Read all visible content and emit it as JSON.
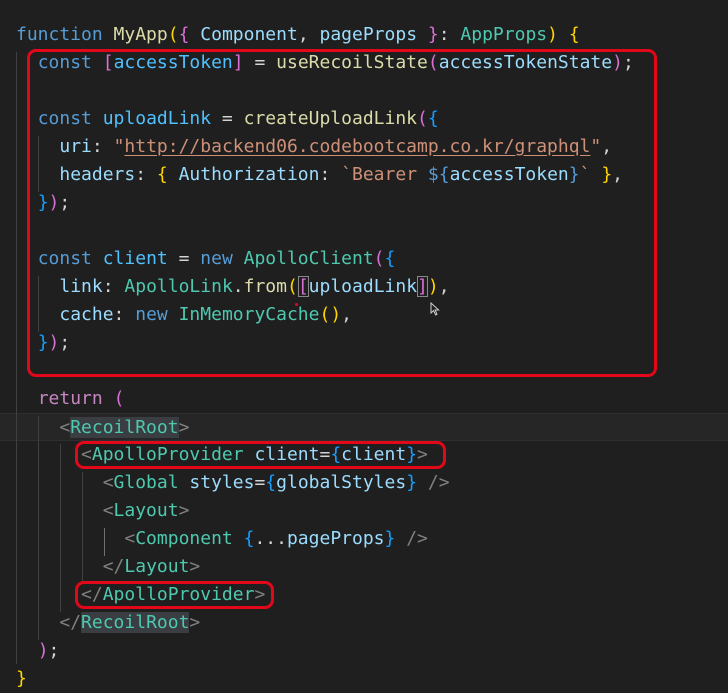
{
  "editor": {
    "colors": {
      "background": "#1f1f1f",
      "keyword": "#569cd6",
      "control_keyword": "#c586c0",
      "function": "#dcdcaa",
      "variable": "#9cdcfe",
      "constant": "#4fc1ff",
      "type": "#4ec9b0",
      "string": "#ce9178",
      "bracket_level_1": "#ffd700",
      "bracket_level_2": "#da70d6",
      "bracket_level_3": "#179fff",
      "highlight_box": "#e3071a"
    },
    "highlight_boxes": [
      "const-block-highlight",
      "apollo-provider-open-highlight",
      "apollo-provider-close-highlight"
    ],
    "mouse_pointer_icon": "text-arrow-cursor",
    "lines": [
      {
        "t": [
          [
            "function",
            "kw"
          ],
          [
            " ",
            "pn"
          ],
          [
            "MyApp",
            "fn"
          ],
          [
            "(",
            "b1"
          ],
          [
            "{",
            "b2"
          ],
          [
            " ",
            "pn"
          ],
          [
            "Component",
            "vr"
          ],
          [
            ", ",
            "pn"
          ],
          [
            "pageProps",
            "vr"
          ],
          [
            " ",
            "pn"
          ],
          [
            "}",
            "b2"
          ],
          [
            ": ",
            "pn"
          ],
          [
            "AppProps",
            "ty"
          ],
          [
            ")",
            "b1"
          ],
          [
            " ",
            "pn"
          ],
          [
            "{",
            "b1"
          ]
        ]
      },
      {
        "t": [
          [
            "  ",
            "pn"
          ],
          [
            "const",
            "kw"
          ],
          [
            " ",
            "pn"
          ],
          [
            "[",
            "b2"
          ],
          [
            "accessToken",
            "cn"
          ],
          [
            "]",
            "b2"
          ],
          [
            " = ",
            "pn"
          ],
          [
            "useRecoilState",
            "fn"
          ],
          [
            "(",
            "b2"
          ],
          [
            "accessTokenState",
            "vr"
          ],
          [
            ")",
            "b2"
          ],
          [
            ";",
            "pn"
          ]
        ]
      },
      {
        "t": []
      },
      {
        "t": [
          [
            "  ",
            "pn"
          ],
          [
            "const",
            "kw"
          ],
          [
            " ",
            "pn"
          ],
          [
            "uploadLink",
            "cn"
          ],
          [
            " = ",
            "pn"
          ],
          [
            "createUploadLink",
            "fn"
          ],
          [
            "(",
            "b2"
          ],
          [
            "{",
            "b3"
          ]
        ]
      },
      {
        "t": [
          [
            "    ",
            "pn"
          ],
          [
            "uri",
            "vr"
          ],
          [
            ": ",
            "pn"
          ],
          [
            "\"",
            "st"
          ],
          [
            "http://backend06.codebootcamp.co.kr/graphql",
            "st url"
          ],
          [
            "\"",
            "st"
          ],
          [
            ",",
            "pn"
          ]
        ]
      },
      {
        "t": [
          [
            "    ",
            "pn"
          ],
          [
            "headers",
            "vr"
          ],
          [
            ": ",
            "pn"
          ],
          [
            "{",
            "b1"
          ],
          [
            " ",
            "pn"
          ],
          [
            "Authorization",
            "vr"
          ],
          [
            ": ",
            "pn"
          ],
          [
            "`Bearer ",
            "st"
          ],
          [
            "${",
            "tpl"
          ],
          [
            "accessToken",
            "vr"
          ],
          [
            "}",
            "tpl"
          ],
          [
            "`",
            "st"
          ],
          [
            " ",
            "pn"
          ],
          [
            "}",
            "b1"
          ],
          [
            ",",
            "pn"
          ]
        ]
      },
      {
        "t": [
          [
            "  ",
            "pn"
          ],
          [
            "}",
            "b3"
          ],
          [
            ")",
            "b2"
          ],
          [
            ";",
            "pn"
          ]
        ]
      },
      {
        "t": []
      },
      {
        "t": [
          [
            "  ",
            "pn"
          ],
          [
            "const",
            "kw"
          ],
          [
            " ",
            "pn"
          ],
          [
            "client",
            "cn"
          ],
          [
            " = ",
            "pn"
          ],
          [
            "new",
            "kw"
          ],
          [
            " ",
            "pn"
          ],
          [
            "ApolloClient",
            "ty"
          ],
          [
            "(",
            "b2"
          ],
          [
            "{",
            "b3"
          ]
        ]
      },
      {
        "t": [
          [
            "    ",
            "pn"
          ],
          [
            "link",
            "vr"
          ],
          [
            ": ",
            "pn"
          ],
          [
            "ApolloLink",
            "ty"
          ],
          [
            ".",
            "pn"
          ],
          [
            "from",
            "fn"
          ],
          [
            "(",
            "b1"
          ],
          [
            "[",
            "b2 bracket-match"
          ],
          [
            "uploadLink",
            "vr"
          ],
          [
            "]",
            "b2 bracket-match"
          ],
          [
            ")",
            "b1"
          ],
          [
            ",",
            "pn"
          ]
        ]
      },
      {
        "t": [
          [
            "    ",
            "pn"
          ],
          [
            "cache",
            "vr"
          ],
          [
            ": ",
            "pn"
          ],
          [
            "new",
            "kw"
          ],
          [
            " ",
            "pn"
          ],
          [
            "InMemoryCache",
            "ty"
          ],
          [
            "()",
            "b1"
          ],
          [
            ",",
            "pn"
          ]
        ]
      },
      {
        "t": [
          [
            "  ",
            "pn"
          ],
          [
            "}",
            "b3"
          ],
          [
            ")",
            "b2"
          ],
          [
            ";",
            "pn"
          ]
        ]
      },
      {
        "t": []
      },
      {
        "t": [
          [
            "  ",
            "pn"
          ],
          [
            "return",
            "ctl"
          ],
          [
            " ",
            "pn"
          ],
          [
            "(",
            "b2"
          ]
        ]
      },
      {
        "t": [
          [
            "    ",
            "pn"
          ],
          [
            "<",
            "ang"
          ],
          [
            "RecoilRoot",
            "tg tag-match"
          ],
          [
            ">",
            "ang"
          ]
        ]
      },
      {
        "t": [
          [
            "      ",
            "pn"
          ],
          [
            "<",
            "ang"
          ],
          [
            "ApolloProvider",
            "tg"
          ],
          [
            " ",
            "pn"
          ],
          [
            "client",
            "at"
          ],
          [
            "=",
            "pn"
          ],
          [
            "{",
            "b3"
          ],
          [
            "client",
            "vr"
          ],
          [
            "}",
            "b3"
          ],
          [
            ">",
            "ang"
          ]
        ]
      },
      {
        "t": [
          [
            "        ",
            "pn"
          ],
          [
            "<",
            "ang"
          ],
          [
            "Global",
            "tg"
          ],
          [
            " ",
            "pn"
          ],
          [
            "styles",
            "at"
          ],
          [
            "=",
            "pn"
          ],
          [
            "{",
            "b3"
          ],
          [
            "globalStyles",
            "vr"
          ],
          [
            "}",
            "b3"
          ],
          [
            " ",
            "pn"
          ],
          [
            "/>",
            "ang"
          ]
        ]
      },
      {
        "t": [
          [
            "        ",
            "pn"
          ],
          [
            "<",
            "ang"
          ],
          [
            "Layout",
            "tg"
          ],
          [
            ">",
            "ang"
          ]
        ]
      },
      {
        "t": [
          [
            "          ",
            "pn"
          ],
          [
            "<",
            "ang"
          ],
          [
            "Component",
            "tg"
          ],
          [
            " ",
            "pn"
          ],
          [
            "{",
            "b3"
          ],
          [
            "...",
            "pn"
          ],
          [
            "pageProps",
            "vr"
          ],
          [
            "}",
            "b3"
          ],
          [
            " ",
            "pn"
          ],
          [
            "/>",
            "ang"
          ]
        ]
      },
      {
        "t": [
          [
            "        ",
            "pn"
          ],
          [
            "</",
            "ang"
          ],
          [
            "Layout",
            "tg"
          ],
          [
            ">",
            "ang"
          ]
        ]
      },
      {
        "t": [
          [
            "      ",
            "pn"
          ],
          [
            "</",
            "ang"
          ],
          [
            "ApolloProvider",
            "tg"
          ],
          [
            ">",
            "ang"
          ]
        ]
      },
      {
        "t": [
          [
            "    ",
            "pn"
          ],
          [
            "</",
            "ang"
          ],
          [
            "RecoilRoot",
            "tg tag-match"
          ],
          [
            ">",
            "ang"
          ]
        ]
      },
      {
        "t": [
          [
            "  ",
            "pn"
          ],
          [
            ")",
            "b2"
          ],
          [
            ";",
            "pn"
          ]
        ]
      },
      {
        "t": [
          [
            "}",
            "b1"
          ]
        ]
      }
    ]
  }
}
